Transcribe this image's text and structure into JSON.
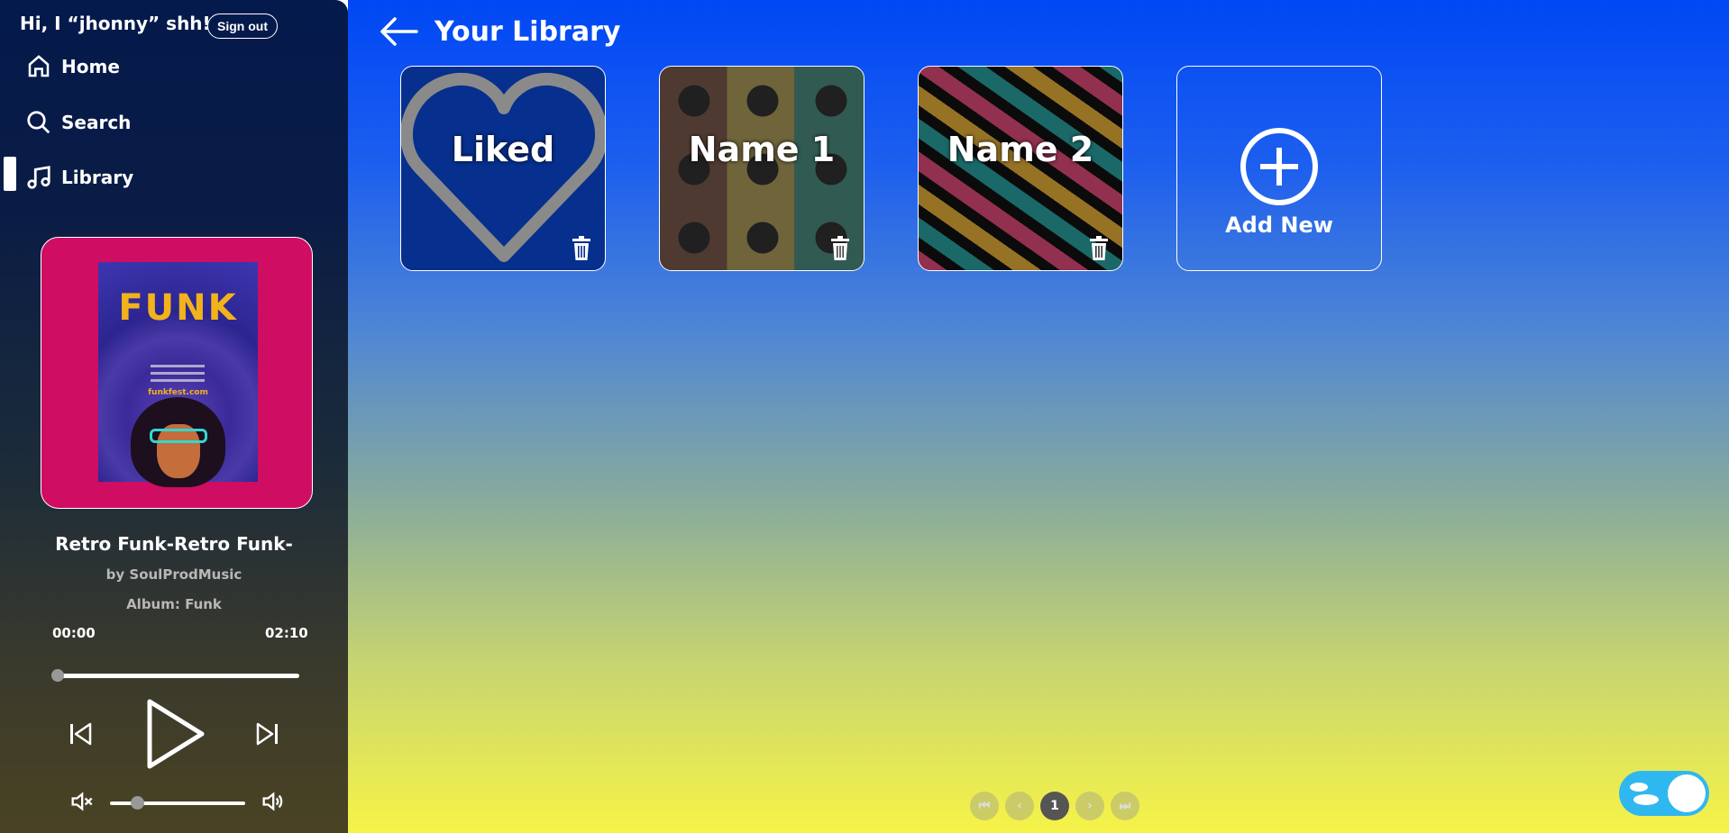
{
  "sidebar": {
    "greeting": "Hi, I “jhonny” shh!",
    "signout_label": "Sign out",
    "nav": [
      {
        "label": "Home",
        "icon": "home-icon"
      },
      {
        "label": "Search",
        "icon": "search-icon"
      },
      {
        "label": "Library",
        "icon": "music-note-icon",
        "active": true
      }
    ]
  },
  "player": {
    "poster_title": "FUNK",
    "poster_url": "funkfest.com",
    "title": "Retro Funk-Retro Funk-",
    "artist": "by SoulProdMusic",
    "album": "Album: Funk",
    "current_time": "00:00",
    "duration": "02:10",
    "progress": 0,
    "volume": 0.2,
    "controls": [
      "skip-back-icon",
      "play-icon",
      "skip-forward-icon"
    ]
  },
  "main": {
    "title": "Your Library",
    "cards": [
      {
        "label": "Liked",
        "style": "liked"
      },
      {
        "label": "Name 1",
        "style": "vinyl"
      },
      {
        "label": "Name 2",
        "style": "tape"
      }
    ],
    "add_new_label": "Add New",
    "pagination": {
      "current": "1"
    }
  },
  "colors": {
    "accent": "#0047f5",
    "bottom_gradient": "#f6f348",
    "album_bg": "#cf0d63",
    "toggle": "#2fb8f0"
  }
}
